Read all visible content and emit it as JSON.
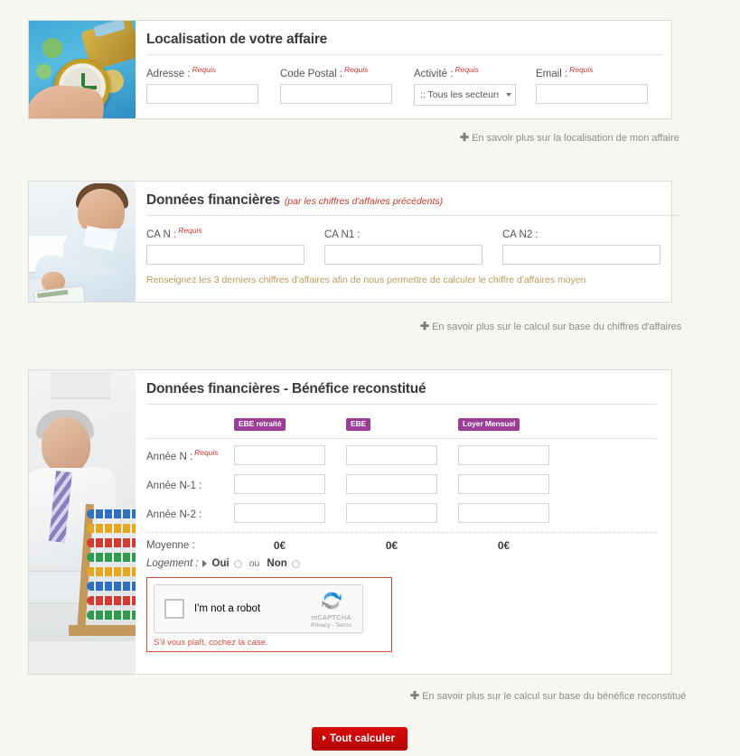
{
  "colors": {
    "page_background": "#f7f7f2",
    "panel_background": "#ffffff",
    "required_red": "#cf3a33",
    "hint_gold": "#bc9a5f",
    "badge_purple": "#9b3c97",
    "submit_red": "#cc0000",
    "captcha_error_red": "#d9483b",
    "link_grey": "#8d8d86"
  },
  "sections": {
    "localisation": {
      "title": "Localisation de votre affaire",
      "image_name": "compass-on-world-map-photo",
      "fields": [
        {
          "label": "Adresse :",
          "required_tag": "Requis",
          "value": "",
          "placeholder": "",
          "type": "text"
        },
        {
          "label": "Code Postal :",
          "required_tag": "Requis",
          "value": "",
          "placeholder": "",
          "type": "text"
        },
        {
          "label": "Activité :",
          "required_tag": "Requis",
          "value": ":: Tous les secteurs d",
          "type": "select",
          "options": [
            ":: Tous les secteurs d"
          ]
        },
        {
          "label": "Email :",
          "required_tag": "Requis",
          "value": "",
          "placeholder": "",
          "type": "text"
        }
      ],
      "more_link": "En savoir plus sur la localisation de mon affaire"
    },
    "donnees_financieres": {
      "title": "Données financières",
      "subtitle": "(par les chiffres d'affaires précédents)",
      "image_name": "man-using-calculator-photo",
      "fields": [
        {
          "label": "CA N :",
          "required_tag": "Requis",
          "value": "",
          "placeholder": ""
        },
        {
          "label": "CA N1 :",
          "required_tag": "",
          "value": "",
          "placeholder": ""
        },
        {
          "label": "CA N2 :",
          "required_tag": "",
          "value": "",
          "placeholder": ""
        }
      ],
      "hint": "Renseignez les 3 derniers chiffres d'affaires afin de nous permettre de calculer le chiffre d'affaires moyen",
      "more_link": "En savoir plus sur le calcul sur base du chiffres d'affaires"
    },
    "benefice_reconstitue": {
      "title": "Données financières - Bénéfice reconstitué",
      "image_name": "man-with-abacus-photo",
      "column_badges": [
        "EBE retraité",
        "EBE",
        "Loyer Mensuel"
      ],
      "rows": [
        {
          "label": "Année N :",
          "required_tag": "Requis",
          "values": [
            "",
            "",
            ""
          ]
        },
        {
          "label": "Année N-1 :",
          "required_tag": "",
          "values": [
            "",
            "",
            ""
          ]
        },
        {
          "label": "Année N-2 :",
          "required_tag": "",
          "values": [
            "",
            "",
            ""
          ]
        }
      ],
      "average": {
        "label": "Moyenne :",
        "values": [
          "0€",
          "0€",
          "0€"
        ]
      },
      "logement": {
        "label": "Logement :",
        "yes_label": "Oui",
        "or_label": "ou",
        "no_label": "Non",
        "selected": ""
      },
      "captcha": {
        "checkbox_label": "I'm not a robot",
        "brand": "reCAPTCHA",
        "terms": "Privacy - Terms",
        "error": "S'il vous plaît, cochez la case."
      },
      "more_link": "En savoir plus sur le calcul sur base du bénéfice reconstitué"
    }
  },
  "submit": {
    "label": "Tout calculer"
  }
}
